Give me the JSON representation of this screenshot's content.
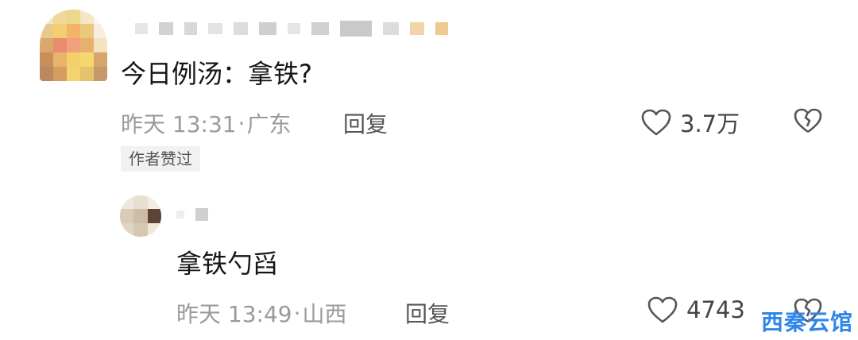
{
  "comment": {
    "text": "今日例汤：拿铁?",
    "time": "昨天 13:31",
    "location": "广东",
    "reply_label": "回复",
    "badge": "作者赞过",
    "likes": "3.7万"
  },
  "reply": {
    "text": "拿铁勺舀",
    "time": "昨天 13:49",
    "location": "山西",
    "reply_label": "回复",
    "likes": "4743"
  },
  "separator": "·",
  "watermark": "西秦云馆",
  "icons": [
    "heart-outline-icon",
    "broken-heart-icon"
  ]
}
